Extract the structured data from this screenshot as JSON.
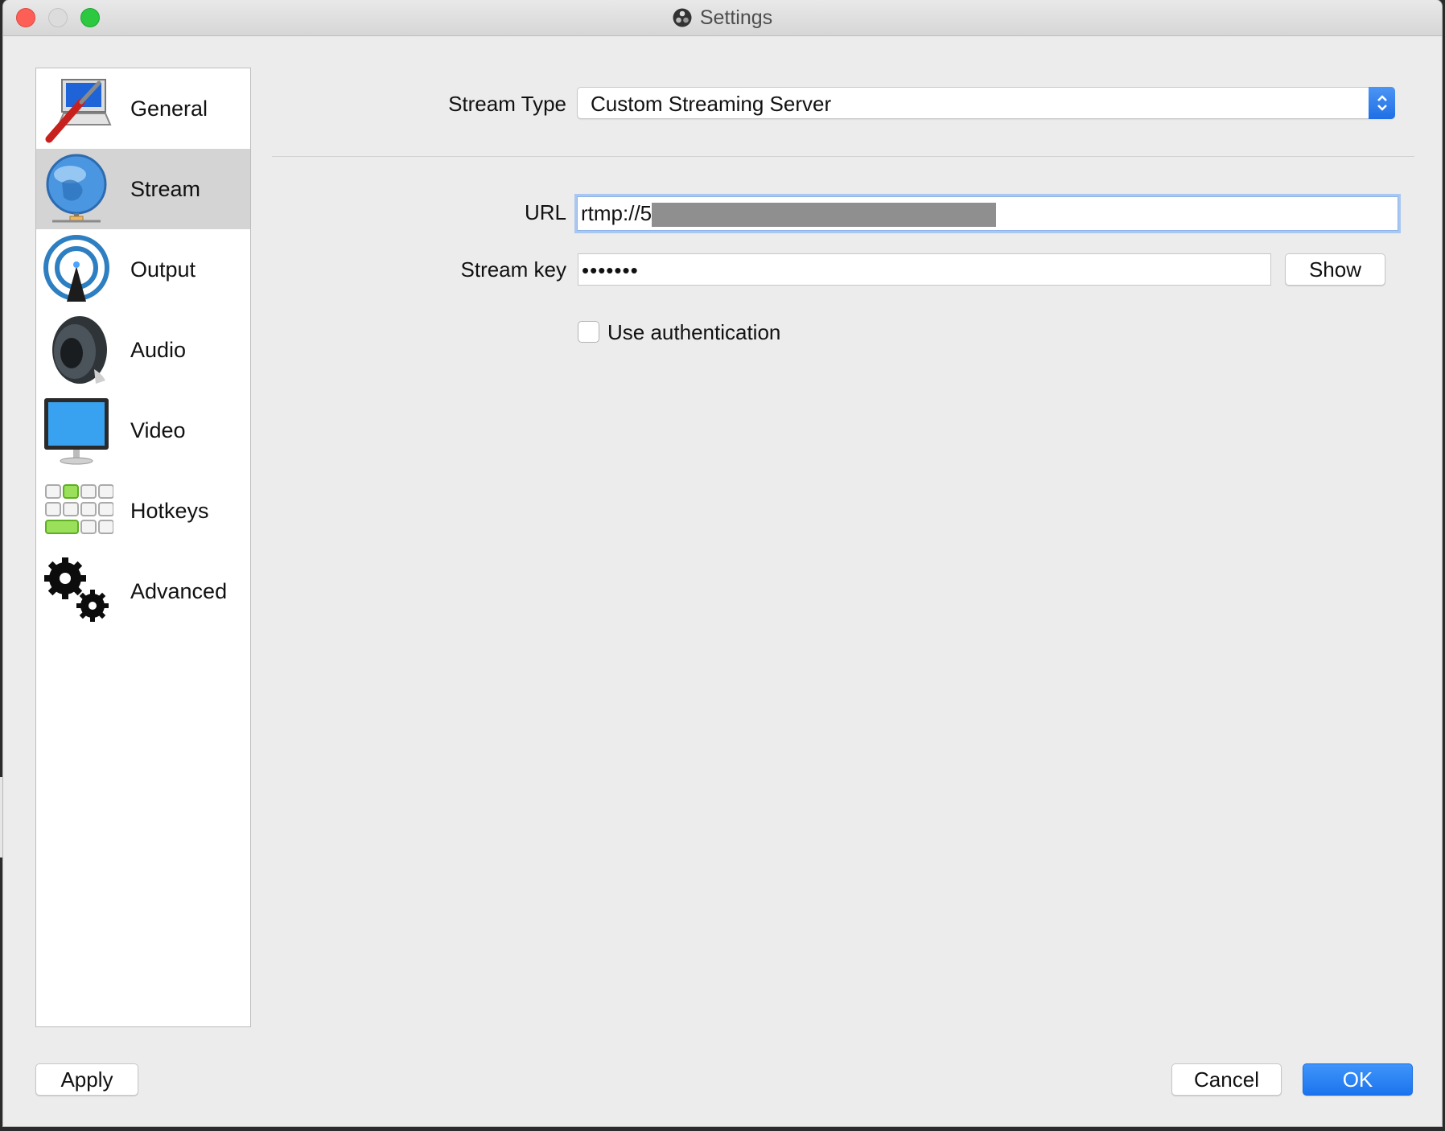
{
  "window": {
    "title": "Settings"
  },
  "sidebar": {
    "items": [
      {
        "label": "General",
        "icon": "general-icon",
        "selected": false
      },
      {
        "label": "Stream",
        "icon": "globe-icon",
        "selected": true
      },
      {
        "label": "Output",
        "icon": "antenna-icon",
        "selected": false
      },
      {
        "label": "Audio",
        "icon": "speaker-icon",
        "selected": false
      },
      {
        "label": "Video",
        "icon": "monitor-icon",
        "selected": false
      },
      {
        "label": "Hotkeys",
        "icon": "keyboard-icon",
        "selected": false
      },
      {
        "label": "Advanced",
        "icon": "gears-icon",
        "selected": false
      }
    ]
  },
  "stream": {
    "type_label": "Stream Type",
    "type_value": "Custom Streaming Server",
    "url_label": "URL",
    "url_value": "rtmp://5",
    "key_label": "Stream key",
    "key_value": "•••••••",
    "show_label": "Show",
    "auth_label": "Use authentication",
    "auth_checked": false
  },
  "footer": {
    "apply": "Apply",
    "cancel": "Cancel",
    "ok": "OK"
  },
  "colors": {
    "selection": "#d4d4d4",
    "accent": "#1b74ee",
    "focus": "#a9c7f0"
  }
}
